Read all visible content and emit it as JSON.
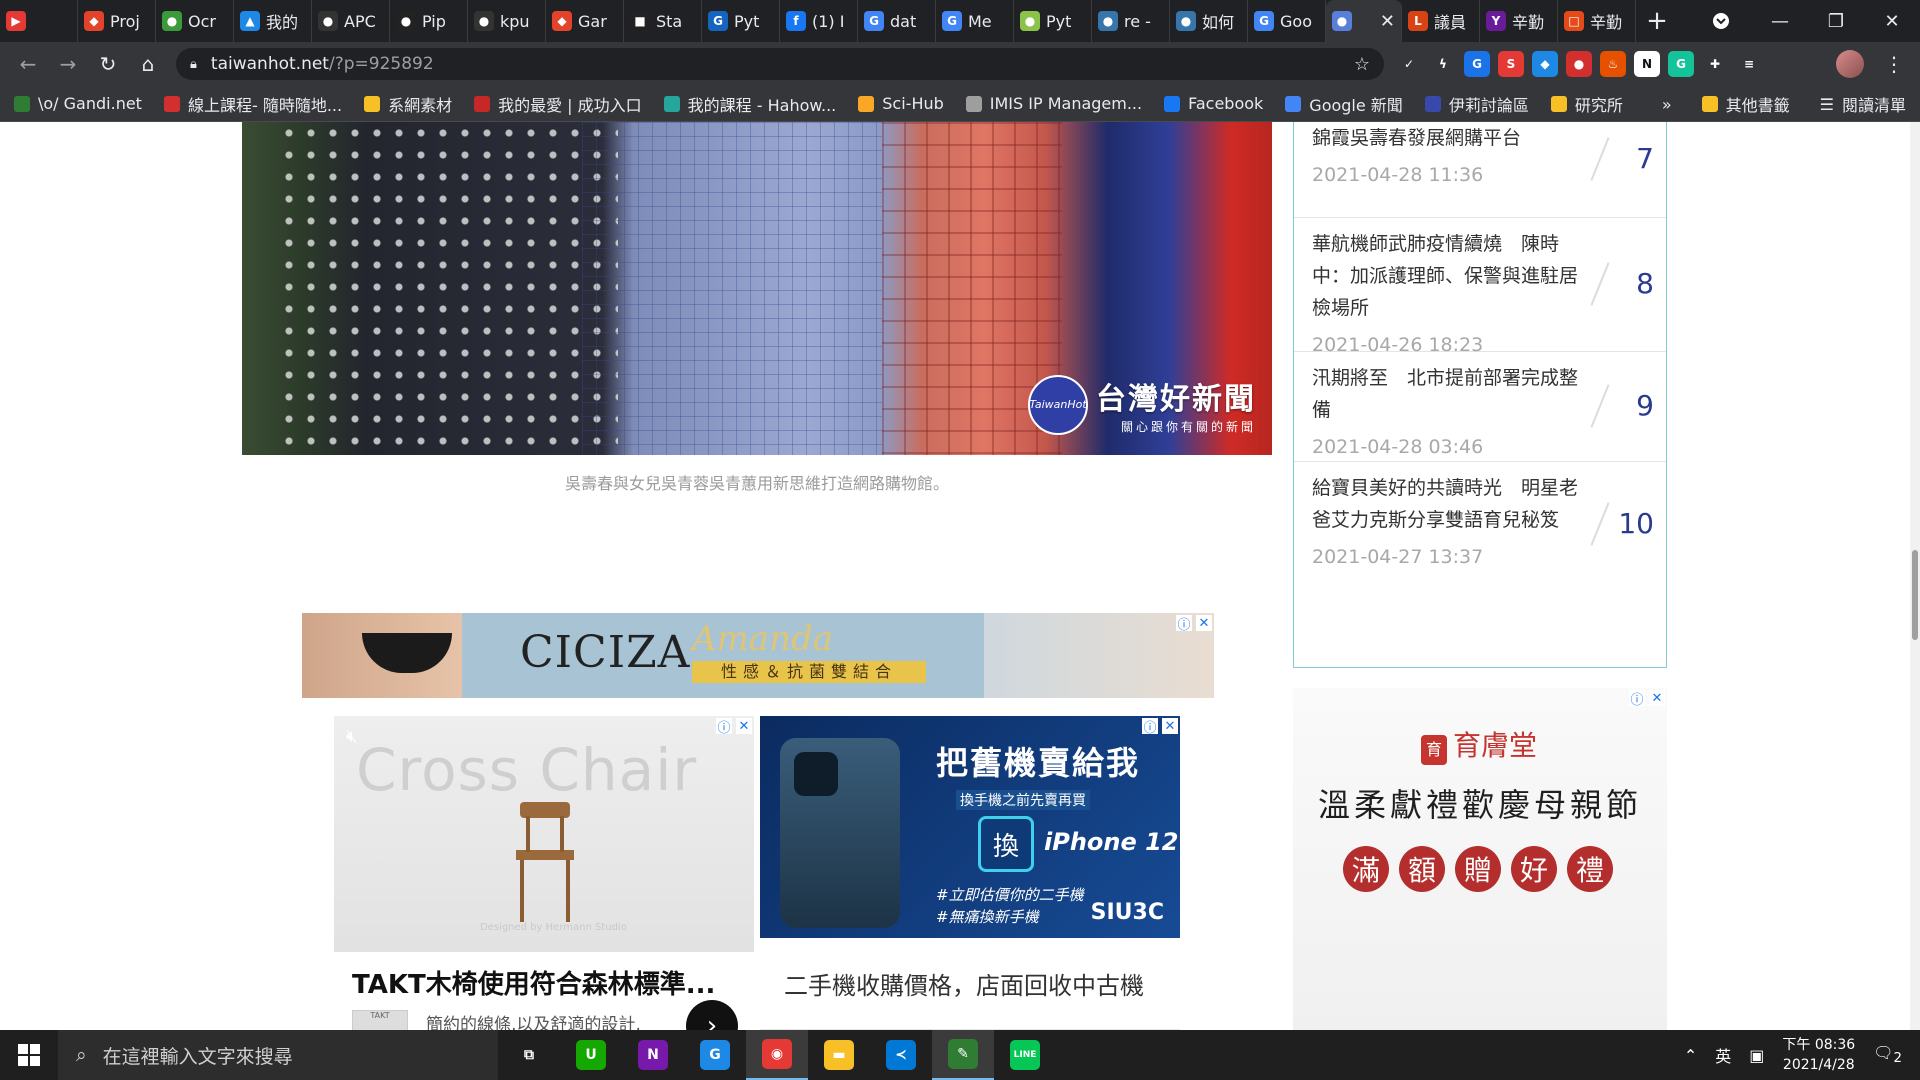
{
  "tabs": [
    {
      "label": "",
      "color": "#e53935",
      "glyph": "▶"
    },
    {
      "label": "Proj",
      "color": "#e2432a",
      "glyph": "◆"
    },
    {
      "label": "Ocr",
      "color": "#3b9b3b",
      "glyph": "●"
    },
    {
      "label": "我的",
      "color": "#1e88e5",
      "glyph": "▲"
    },
    {
      "label": "APC",
      "color": "#333333",
      "glyph": "●"
    },
    {
      "label": "Pip",
      "color": "#222222",
      "glyph": "●"
    },
    {
      "label": "kpu",
      "color": "#333333",
      "glyph": "●"
    },
    {
      "label": "Gar",
      "color": "#e2432a",
      "glyph": "◆"
    },
    {
      "label": "Sta",
      "color": "#222222",
      "glyph": "■"
    },
    {
      "label": "Pyt",
      "color": "#1565c0",
      "glyph": "G"
    },
    {
      "label": "(1) I",
      "color": "#1877f2",
      "glyph": "f"
    },
    {
      "label": "dat",
      "color": "#4285f4",
      "glyph": "G"
    },
    {
      "label": "Me",
      "color": "#4285f4",
      "glyph": "G"
    },
    {
      "label": "Pyt",
      "color": "#8bc34a",
      "glyph": "●"
    },
    {
      "label": "re -",
      "color": "#3776ab",
      "glyph": "●"
    },
    {
      "label": "如何",
      "color": "#3776ab",
      "glyph": "●"
    },
    {
      "label": "Goo",
      "color": "#4285f4",
      "glyph": "G"
    },
    {
      "label": "",
      "color": "#5a7fd8",
      "glyph": "●",
      "active": true
    },
    {
      "label": "議員",
      "color": "#d84315",
      "glyph": "L"
    },
    {
      "label": "辛勤",
      "color": "#6a1b9a",
      "glyph": "Y"
    },
    {
      "label": "辛勤",
      "color": "#e64a19",
      "glyph": "□"
    }
  ],
  "browser": {
    "url_host": "taiwanhot.net",
    "url_path": "/?p=925892",
    "new_tab": "+",
    "close_tab": "✕"
  },
  "extensions": [
    {
      "name": "check-icon",
      "color": "#35363a",
      "glyph": "✓"
    },
    {
      "name": "bolt-icon",
      "color": "#35363a",
      "glyph": "ϟ"
    },
    {
      "name": "translate-icon",
      "color": "#1a73e8",
      "glyph": "G"
    },
    {
      "name": "s-icon",
      "color": "#e53935",
      "glyph": "S"
    },
    {
      "name": "shield-icon",
      "color": "#1e88e5",
      "glyph": "◆"
    },
    {
      "name": "record-icon",
      "color": "#d32f2f",
      "glyph": "●"
    },
    {
      "name": "fire-icon",
      "color": "#e65100",
      "glyph": "♨"
    },
    {
      "name": "notion-icon",
      "color": "#ffffff",
      "glyph": "N"
    },
    {
      "name": "grammarly-icon",
      "color": "#15c39a",
      "glyph": "G"
    },
    {
      "name": "puzzle-icon",
      "color": "#35363a",
      "glyph": "✚"
    },
    {
      "name": "playlist-icon",
      "color": "#35363a",
      "glyph": "≡"
    }
  ],
  "bookmarks": [
    {
      "label": "\\o/ Gandi.net",
      "color": "#2e7d32"
    },
    {
      "label": "線上課程- 隨時隨地...",
      "color": "#d32f2f"
    },
    {
      "label": "系網素材",
      "color": "#f6c026"
    },
    {
      "label": "我的最愛 | 成功入口",
      "color": "#c62828"
    },
    {
      "label": "我的課程 - Hahow...",
      "color": "#26a69a"
    },
    {
      "label": "Sci-Hub",
      "color": "#f9a825"
    },
    {
      "label": "IMIS IP Managem...",
      "color": "#9e9e9e"
    },
    {
      "label": "Facebook",
      "color": "#1877f2"
    },
    {
      "label": "Google 新聞",
      "color": "#4285f4"
    },
    {
      "label": "伊莉討論區",
      "color": "#3949ab"
    },
    {
      "label": "研究所",
      "color": "#f6c026"
    }
  ],
  "bookmarks_right": {
    "more": "»",
    "other": "其他書籤",
    "reading": "閱讀清單"
  },
  "photo": {
    "watermark_logo": "TaiwanHot",
    "watermark_title": "台灣好新聞",
    "watermark_sub": "關心跟你有關的新聞"
  },
  "caption": "吳壽春與女兒吳青蓉吳青蕙用新思維打造網路購物館。",
  "banner_ad": {
    "brand": "CICIZA",
    "script": "Amanda",
    "tagline": "性感＆抗菌雙結合"
  },
  "ad_card_1": {
    "overlay": "Cross Chair",
    "credit": "Designed by Hermann Studio",
    "title": "TAKT木椅使用符合森林標準...",
    "thumb": "TAKT",
    "desc": "簡約的線條,以及舒適的設計,"
  },
  "ad_card_2": {
    "headline": "把舊機賣給我",
    "sub": "換手機之前先賣再買",
    "swap": "換",
    "model": "iPhone 12",
    "tag1": "#立即估價你的二手機",
    "tag2": "#無痛換新手機",
    "brand": "SIU3C",
    "title": "二手機收購價格，店面回收中古機"
  },
  "sidebar_list": [
    {
      "title": "吉菜賣廳　阿霞飯店子創辦人吳錦霞吳壽春發展網購平台",
      "time": "2021-04-28 11:36",
      "num": "7"
    },
    {
      "title": "華航機師武肺疫情續燒　陳時中：加派護理師、保警與進駐居檢場所",
      "time": "2021-04-26 18:23",
      "num": "8"
    },
    {
      "title": "汛期將至　北市提前部署完成整備",
      "time": "2021-04-28 03:46",
      "num": "9"
    },
    {
      "title": "給寶貝美好的共讀時光　明星老爸艾力克斯分享雙語育兒秘笈",
      "time": "2021-04-27 13:37",
      "num": "10"
    }
  ],
  "right_ad": {
    "brand_seal": "育",
    "brand": "育膚堂",
    "headline": "溫柔獻禮歡慶母親節",
    "circles": [
      "滿",
      "額",
      "贈",
      "好",
      "禮"
    ]
  },
  "taskbar": {
    "search_placeholder": "在這裡輸入文字來搜尋",
    "apps": [
      {
        "name": "task-view",
        "glyph": "⧉",
        "color": "#1f1f1f"
      },
      {
        "name": "upwork",
        "glyph": "U",
        "color": "#14a800"
      },
      {
        "name": "onenote",
        "glyph": "N",
        "color": "#7719aa"
      },
      {
        "name": "edge-dev",
        "glyph": "G",
        "color": "#1e88e5"
      },
      {
        "name": "chrome",
        "glyph": "◉",
        "color": "#e53935",
        "active": true
      },
      {
        "name": "file-explorer",
        "glyph": "▬",
        "color": "#f6c026"
      },
      {
        "name": "vscode",
        "glyph": "≺",
        "color": "#0078d4"
      },
      {
        "name": "pen-app",
        "glyph": "✎",
        "color": "#2e7d32",
        "active": true
      },
      {
        "name": "line",
        "glyph": "LINE",
        "color": "#06c755"
      }
    ],
    "ime": "英",
    "time": "下午 08:36",
    "date": "2021/4/28",
    "notifications": "2"
  }
}
